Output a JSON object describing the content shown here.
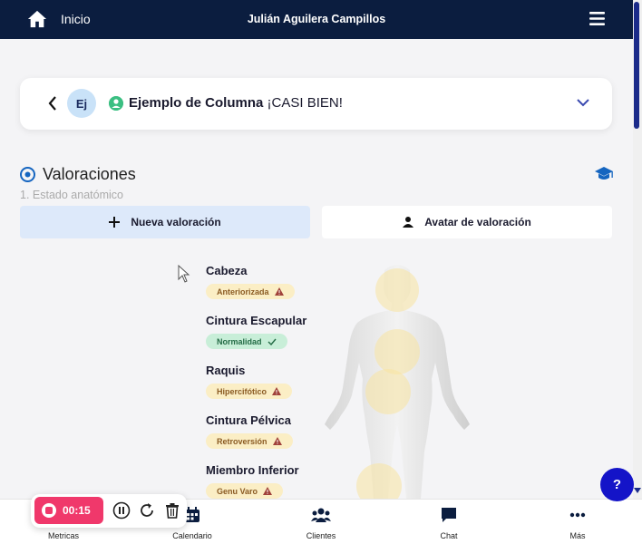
{
  "topbar": {
    "home_label": "Inicio",
    "user_name": "Julián Aguilera Campillos"
  },
  "routine": {
    "avatar_initials": "Ej",
    "title": "Ejemplo de Columna",
    "status": "¡CASI BIEN!"
  },
  "section": {
    "title": "Valoraciones",
    "subtitle": "1. Estado anatómico"
  },
  "buttons": {
    "new_assessment": "Nueva valoración",
    "avatar_assessment": "Avatar de valoración"
  },
  "regions": [
    {
      "name": "Cabeza",
      "tag": "Anteriorizada",
      "status": "warning"
    },
    {
      "name": "Cintura Escapular",
      "tag": "Normalidad",
      "status": "ok"
    },
    {
      "name": "Raquis",
      "tag": "Hipercifótico",
      "status": "warning"
    },
    {
      "name": "Cintura Pélvica",
      "tag": "Retroversión",
      "status": "warning"
    },
    {
      "name": "Miembro Inferior",
      "tag": "Genu Varo",
      "status": "warning"
    }
  ],
  "recorder": {
    "time": "00:15"
  },
  "nav": {
    "metrics": "Metricas",
    "calendar": "Calendario",
    "clients": "Clientes",
    "chat": "Chat",
    "more": "Más"
  },
  "help": {
    "label": "?"
  },
  "colors": {
    "topbar": "#0b1d3f",
    "accent": "#1b2b8a",
    "record": "#f0386b",
    "warning_tag": "#fbeec5",
    "ok_tag": "#c8eed8",
    "help": "#1414c8"
  },
  "icons": [
    "home-icon",
    "menu-icon",
    "back-chevron-icon",
    "user-status-icon",
    "chevron-down-icon",
    "target-icon",
    "graduation-cap-icon",
    "plus-icon",
    "person-icon",
    "warning-icon",
    "check-icon",
    "pause-icon",
    "restart-icon",
    "trash-icon",
    "calendar-icon",
    "clients-icon",
    "chat-icon",
    "more-icon"
  ]
}
